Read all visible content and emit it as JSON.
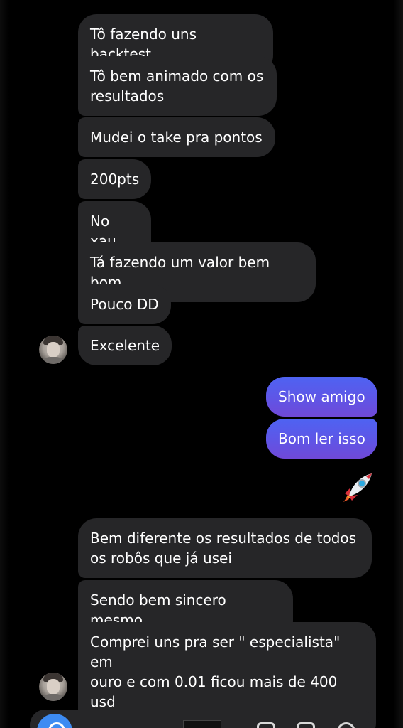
{
  "conversation": {
    "incoming_group_1": [
      "Tô fazendo uns backtest",
      "Tô bem animado com os\nresultados",
      "Mudei o take pra pontos",
      "200pts",
      "No xau",
      "Tá fazendo um valor bem bom",
      "Pouco DD",
      "Excelente"
    ],
    "outgoing": [
      "Show amigo",
      "Bom ler isso"
    ],
    "reaction_emoji": "rocket",
    "incoming_group_2": [
      "Bem diferente os resultados de todos\nos robôs que já usei",
      "Sendo bem sincero mesmo",
      "Comprei uns pra ser \" especialista\" em\nouro e com 0.01 ficou mais de 400 usd\nnegativo"
    ]
  },
  "colors": {
    "incoming_bubble": "#262628",
    "outgoing_gradient_top": "#4e63f2",
    "outgoing_gradient_bottom": "#7049d8",
    "background": "#000000",
    "camera_button": "#3d8bf2"
  },
  "composer": {
    "icons": [
      "camera-icon",
      "image-icon",
      "gallery-icon",
      "sticker-icon"
    ]
  }
}
